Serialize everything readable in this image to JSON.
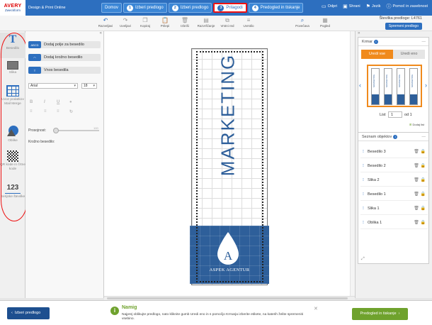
{
  "brand": {
    "logo_line1": "AVERY",
    "logo_line2": "Zweckform"
  },
  "app_title": "Design & Print Online",
  "steps": [
    {
      "label": "Domov"
    },
    {
      "num": "1",
      "label": "Izberi predlogo"
    },
    {
      "num": "2",
      "label": "Izberi predlogo"
    },
    {
      "num": "3",
      "label": "Prilagodi"
    },
    {
      "num": "4",
      "label": "Predogled in tiskanje"
    }
  ],
  "top_links": {
    "open": "Odpri",
    "save": "Shrani",
    "language": "Jezik",
    "help": "Pomoč in zasebnost"
  },
  "toolbar": {
    "tools": [
      "Razveljavi",
      "Uveljavi",
      "Kopiraj",
      "Prilepi",
      "Izbriši",
      "Razvrščanje",
      "Vrstni red",
      "Uvrstilo",
      "Povečava",
      "Pogled"
    ],
    "label_code": "Številka predloge: L4761",
    "prepare": "Spremeni predlogo"
  },
  "rail": [
    {
      "label": "Besedilo",
      "icon": "text-icon"
    },
    {
      "label": "Slika",
      "icon": "image-icon"
    },
    {
      "label": "Uvoz podatkov Mail Merge",
      "icon": "table-icon"
    },
    {
      "label": "Oblike",
      "icon": "shapes-icon"
    },
    {
      "label": "QR kode in črtne kode",
      "icon": "qr-icon"
    },
    {
      "label": "Serijske številke",
      "icon": "serial-icon"
    }
  ],
  "panel": {
    "btn_text_box": "Dodaj polje za besedilo",
    "btn_text_box_badge": "ABCD",
    "btn_curved": "Dodaj krožno besedilo",
    "btn_input": "Vnos besedila",
    "font_family": "Arial",
    "font_size": "18",
    "transparency_label": "Prosojnost:",
    "transparency_value": "100",
    "curved_label": "Krožno besedilo:"
  },
  "canvas": {
    "main_text": "MARKETING",
    "initial": "A",
    "agency": "ASPEK AGENTUR"
  },
  "crop_box": {
    "title": "Krmar",
    "tab_edit_all": "Uredi vse",
    "tab_edit_one": "Uredi eno",
    "sheet_label": "List",
    "sheet_value": "1",
    "of_label": "od 1",
    "add_sheet": "Dodaj list",
    "mini_text": "MARKETING"
  },
  "objects": {
    "title": "Seznam objektov",
    "items": [
      "Besedilo 3",
      "Besedilo 2",
      "Slika 2",
      "Besedilo 1",
      "Slika 1",
      "Oblika 1"
    ]
  },
  "bottom": {
    "back": "Izberi predlogo",
    "hint_title": "Namig",
    "hint_text": "Najprej oblikujte predlogo, nato kliknite gumb Uredi eno in s pomočjo Krmarja izberite etikete, na katerih želite spremeniti vsebino.",
    "next": "Predogled in tiskanje"
  },
  "colors": {
    "primary": "#2d6fbf",
    "label_blue": "#2e5f9a",
    "orange": "#f08a1c",
    "green": "#6fa22d",
    "highlight": "#e11111"
  }
}
